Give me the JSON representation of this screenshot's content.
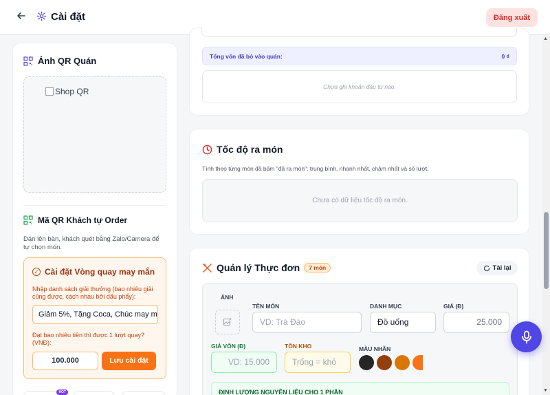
{
  "header": {
    "title": "Cài đặt",
    "logout_label": "Đăng xuất"
  },
  "left": {
    "shop_qr": {
      "title": "Ảnh QR Quán",
      "image_alt": "Shop QR"
    },
    "customer_qr": {
      "title": "Mã QR Khách tự Order",
      "description": "Dán lên bàn, khách quét bằng Zalo/Camera để tự chọn món."
    },
    "spin": {
      "title": "Cài đặt Vòng quay may mắn",
      "prizes_label": "Nhập danh sách giải thưởng (bao nhiêu giải cũng được, cách nhau bởi dấu phẩy):",
      "prizes_value": "Giảm 5%, Tặng Coca, Chúc may mắn",
      "threshold_label": "Đạt bao nhiêu tiền thì được 1 lượt quay? (VNĐ):",
      "threshold_value": "100.000",
      "save_label": "Lưu cài đặt"
    },
    "chip_badge": "HOT"
  },
  "capital": {
    "total_label": "Tổng vốn đã bỏ vào quán:",
    "total_value": "0 ₫",
    "empty_text": "Chưa ghi khoản đầu tư nào."
  },
  "speed": {
    "title": "Tốc độ ra món",
    "description": "Tính theo từng món đã bấm \"đã ra món\": trung bình, nhanh nhất, chậm nhất và số lượt.",
    "empty_text": "Chưa có dữ liệu tốc độ ra món."
  },
  "menu": {
    "title": "Quản lý Thực đơn",
    "count_badge": "7 món",
    "reload_label": "Tải lại",
    "form": {
      "image_label": "ẢNH",
      "name_label": "TÊN MÓN",
      "name_placeholder": "VD: Trà Đào",
      "category_label": "DANH MỤC",
      "category_value": "Đồ uống",
      "price_label": "GIÁ (Đ)",
      "price_value": "25.000",
      "cost_label": "GIÁ VỐN (Đ)",
      "cost_placeholder": "VD: 15.000",
      "stock_label": "TỒN KHO",
      "stock_placeholder": "Trống = khỏ",
      "color_label": "MÀU NHÃN",
      "colors": [
        "#262626",
        "#92400e",
        "#d97706",
        "#f97316"
      ],
      "ingredient_label": "ĐỊNH LƯỢNG NGUYÊN LIỆU CHO 1 PHẦN"
    }
  }
}
